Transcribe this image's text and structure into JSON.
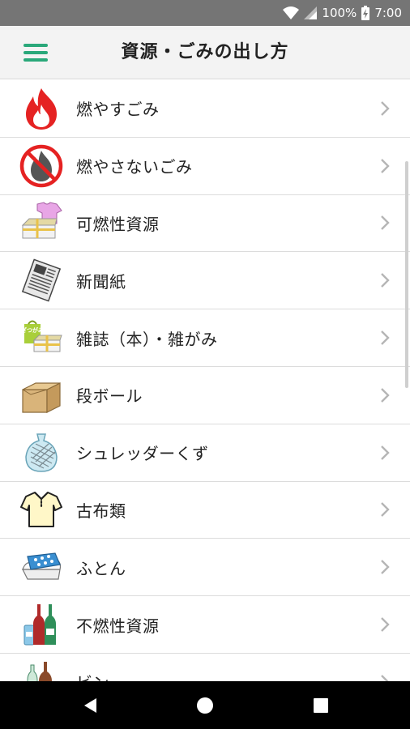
{
  "status_bar": {
    "battery": "100%",
    "time": "7:00",
    "icons": [
      "wifi-icon",
      "cell-signal-icon",
      "battery-charging-icon"
    ]
  },
  "app_bar": {
    "title": "資源・ごみの出し方",
    "menu_icon": "hamburger-menu-icon"
  },
  "colors": {
    "accent": "#2aa87a",
    "status_bar": "#757575",
    "app_bar": "#f3f3f3",
    "nav_bar": "#000000",
    "chevron": "#b5b5b5"
  },
  "items": [
    {
      "label": "燃やすごみ",
      "icon": "fire-icon"
    },
    {
      "label": "燃やさないごみ",
      "icon": "no-burn-icon"
    },
    {
      "label": "可燃性資源",
      "icon": "clothes-paper-bundle-icon"
    },
    {
      "label": "新聞紙",
      "icon": "newspaper-icon"
    },
    {
      "label": "雑誌（本）・雑がみ",
      "icon": "magazine-paper-bag-icon",
      "icon_text": "ざつがみ"
    },
    {
      "label": "段ボール",
      "icon": "cardboard-box-icon"
    },
    {
      "label": "シュレッダーくず",
      "icon": "shredded-paper-bag-icon"
    },
    {
      "label": "古布類",
      "icon": "shirt-icon"
    },
    {
      "label": "ふとん",
      "icon": "futon-icon"
    },
    {
      "label": "不燃性資源",
      "icon": "bottles-icon"
    },
    {
      "label": "ビン",
      "icon": "glass-bottle-icon"
    }
  ],
  "nav_bar": {
    "buttons": [
      "back-icon",
      "home-icon",
      "recents-icon"
    ]
  }
}
